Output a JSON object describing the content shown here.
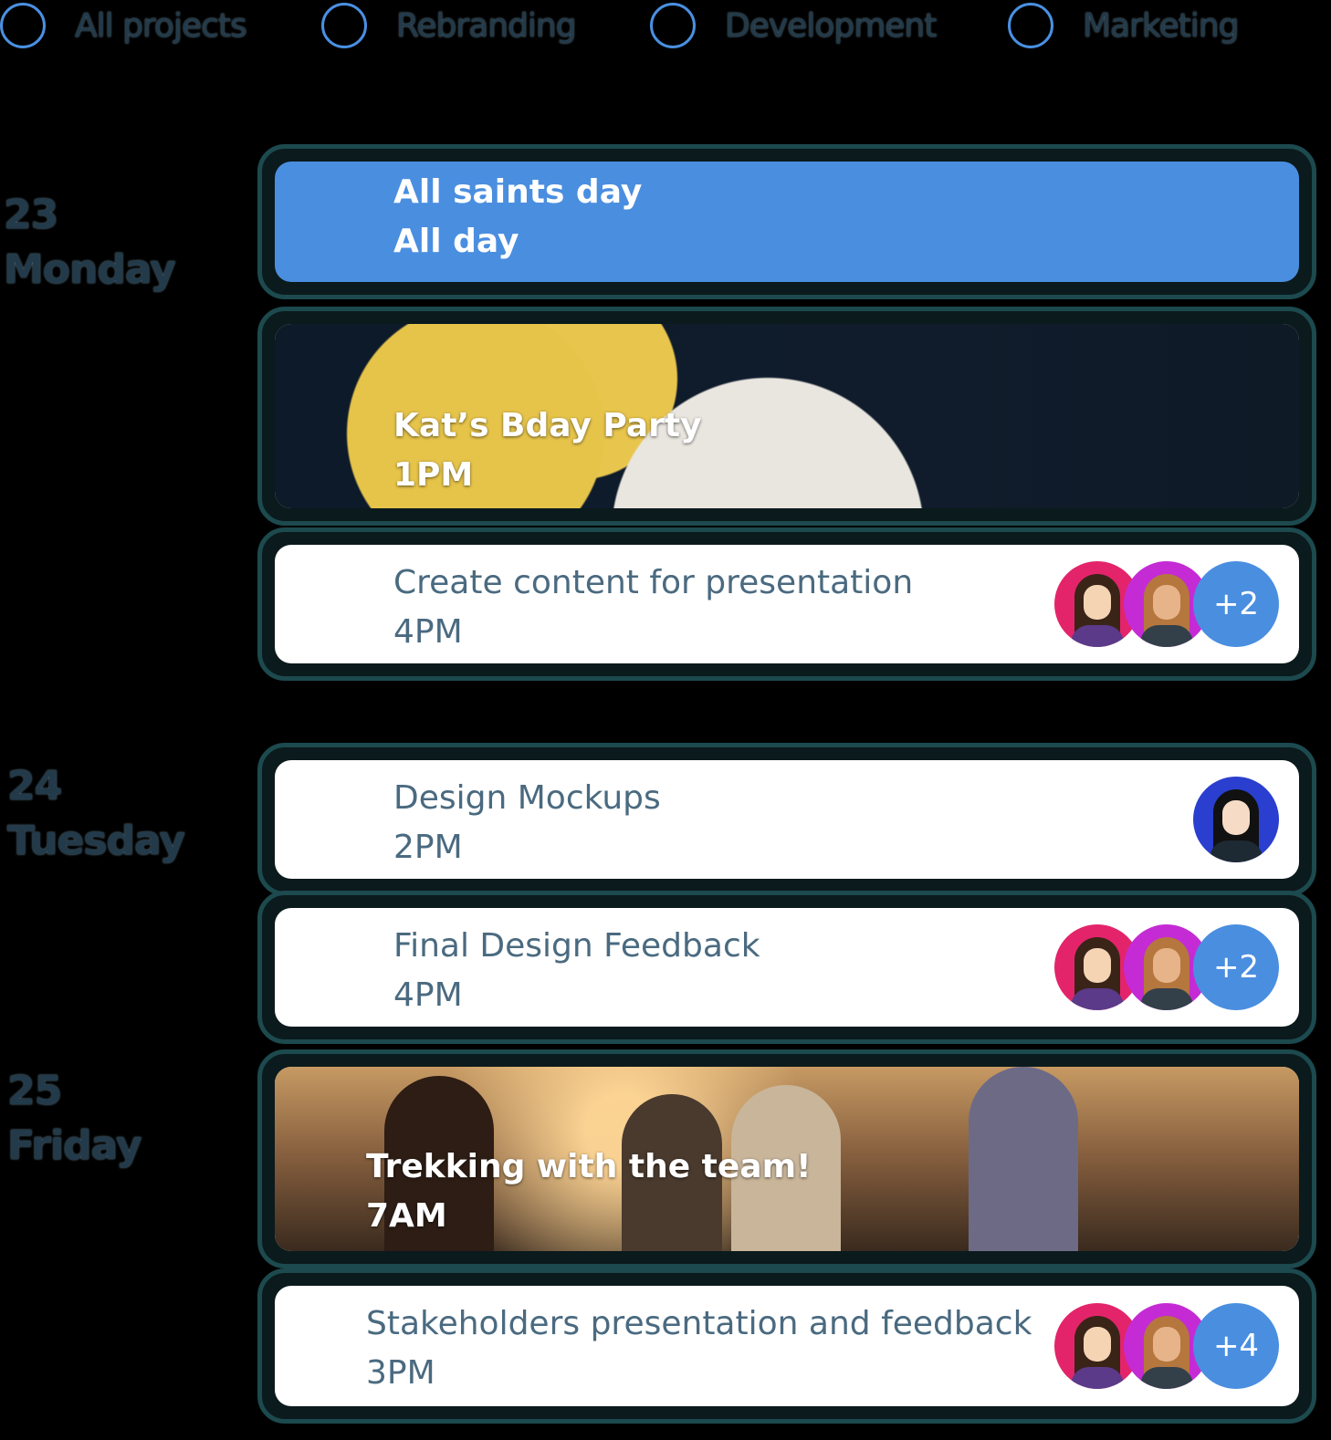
{
  "filters": [
    {
      "label": "All projects"
    },
    {
      "label": "Rebranding"
    },
    {
      "label": "Development"
    },
    {
      "label": "Marketing"
    }
  ],
  "days": [
    {
      "number": "23",
      "name": "Monday"
    },
    {
      "number": "24",
      "name": "Tuesday"
    },
    {
      "number": "25",
      "name": "Friday"
    }
  ],
  "events": [
    {
      "title": "All saints day",
      "time": "All day"
    },
    {
      "title": "Kat’s Bday Party",
      "time": "1PM"
    },
    {
      "title": "Create content for presentation",
      "time": "4PM",
      "extra": "+2"
    },
    {
      "title": "Design Mockups",
      "time": "2PM"
    },
    {
      "title": "Final Design Feedback",
      "time": "4PM",
      "extra": "+2"
    },
    {
      "title": "Trekking with the team!",
      "time": "7AM"
    },
    {
      "title": "Stakeholders presentation and feedback",
      "time": "3PM",
      "extra": "+4"
    }
  ],
  "colors": {
    "accent": "#4a8ee0",
    "card_border": "#1c4a4e",
    "muted_text": "#4a6a80"
  }
}
